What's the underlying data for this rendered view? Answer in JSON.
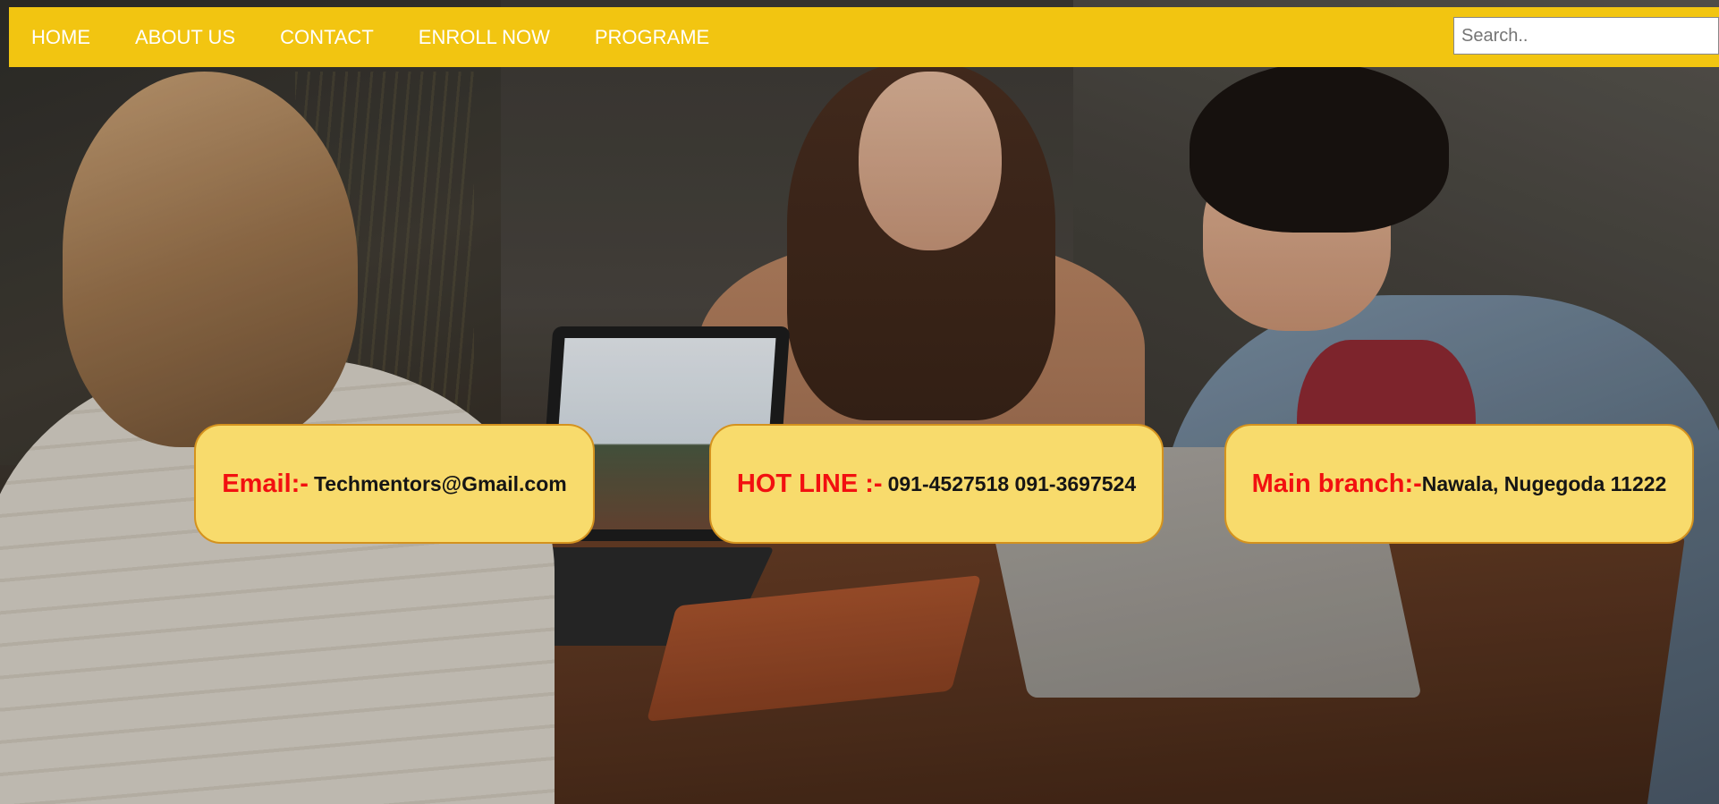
{
  "nav": {
    "items": [
      {
        "label": "HOME"
      },
      {
        "label": "ABOUT US"
      },
      {
        "label": "CONTACT"
      },
      {
        "label": "ENROLL NOW"
      },
      {
        "label": "PROGRAME"
      }
    ],
    "search": {
      "placeholder": "Search..",
      "value": ""
    }
  },
  "cards": {
    "email": {
      "label": "Email:-",
      "value": "Techmentors@Gmail.com"
    },
    "hotline": {
      "label": "HOT LINE :-",
      "value": "091-4527518 091-3697524"
    },
    "branch": {
      "label": "Main branch:-",
      "value": "Nawala, Nugegoda 11222"
    }
  },
  "colors": {
    "navbar_bg": "#f2c511",
    "card_bg": "#f8db6c",
    "card_border": "#d4921e",
    "card_label": "#f21010",
    "card_value": "#151515",
    "nav_text": "#ffffff"
  }
}
